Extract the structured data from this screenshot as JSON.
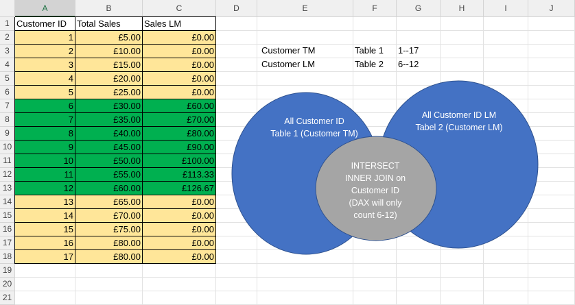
{
  "columns": [
    "A",
    "B",
    "C",
    "D",
    "E",
    "F",
    "G",
    "H",
    "I",
    "J"
  ],
  "selected_column": "A",
  "rows": [
    "1",
    "2",
    "3",
    "4",
    "5",
    "6",
    "7",
    "8",
    "9",
    "10",
    "11",
    "12",
    "13",
    "14",
    "15",
    "16",
    "17",
    "18",
    "19",
    "20",
    "21"
  ],
  "headers": [
    "Customer ID",
    "Total Sales",
    "Sales LM"
  ],
  "table": [
    {
      "id": "1",
      "total": "£5.00",
      "lm": "£0.00",
      "fill": "yellow"
    },
    {
      "id": "2",
      "total": "£10.00",
      "lm": "£0.00",
      "fill": "yellow"
    },
    {
      "id": "3",
      "total": "£15.00",
      "lm": "£0.00",
      "fill": "yellow"
    },
    {
      "id": "4",
      "total": "£20.00",
      "lm": "£0.00",
      "fill": "yellow"
    },
    {
      "id": "5",
      "total": "£25.00",
      "lm": "£0.00",
      "fill": "yellow"
    },
    {
      "id": "6",
      "total": "£30.00",
      "lm": "£60.00",
      "fill": "green"
    },
    {
      "id": "7",
      "total": "£35.00",
      "lm": "£70.00",
      "fill": "green"
    },
    {
      "id": "8",
      "total": "£40.00",
      "lm": "£80.00",
      "fill": "green"
    },
    {
      "id": "9",
      "total": "£45.00",
      "lm": "£90.00",
      "fill": "green"
    },
    {
      "id": "10",
      "total": "£50.00",
      "lm": "£100.00",
      "fill": "green"
    },
    {
      "id": "11",
      "total": "£55.00",
      "lm": "£113.33",
      "fill": "green"
    },
    {
      "id": "12",
      "total": "£60.00",
      "lm": "£126.67",
      "fill": "green"
    },
    {
      "id": "13",
      "total": "£65.00",
      "lm": "£0.00",
      "fill": "yellow"
    },
    {
      "id": "14",
      "total": "£70.00",
      "lm": "£0.00",
      "fill": "yellow"
    },
    {
      "id": "15",
      "total": "£75.00",
      "lm": "£0.00",
      "fill": "yellow"
    },
    {
      "id": "16",
      "total": "£80.00",
      "lm": "£0.00",
      "fill": "yellow"
    },
    {
      "id": "17",
      "total": "£80.00",
      "lm": "£0.00",
      "fill": "yellow"
    }
  ],
  "notes": [
    {
      "name": "Customer TM",
      "table": "Table 1",
      "range": "1--17"
    },
    {
      "name": "Customer LM",
      "table": "Table 2",
      "range": "6--12"
    }
  ],
  "venn": {
    "left_lines": [
      "All Customer ID",
      "Table 1 (Customer TM)"
    ],
    "right_lines": [
      "All Customer ID LM",
      "Tabel 2 (Customer LM)"
    ],
    "center_lines": [
      "INTERSECT",
      "INNER JOIN on",
      "Customer ID",
      "(DAX will only",
      "count 6-12)"
    ]
  },
  "colors": {
    "yellow_fill": "#ffe699",
    "green_fill": "#00b050",
    "circle_blue": "#4472c4",
    "circle_stroke": "#2f528f",
    "intersect_gray": "#a5a5a5",
    "header_accent": "#217346"
  }
}
